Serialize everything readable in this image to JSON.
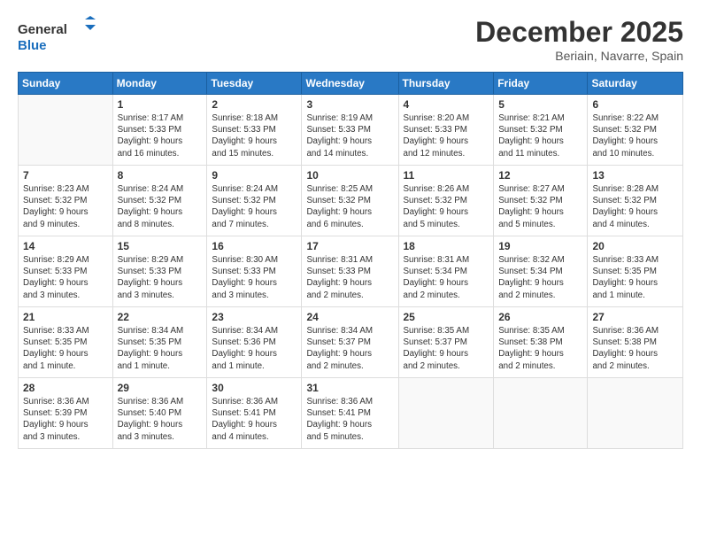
{
  "header": {
    "logo_line1": "General",
    "logo_line2": "Blue",
    "month_year": "December 2025",
    "location": "Beriain, Navarre, Spain"
  },
  "weekdays": [
    "Sunday",
    "Monday",
    "Tuesday",
    "Wednesday",
    "Thursday",
    "Friday",
    "Saturday"
  ],
  "weeks": [
    [
      {
        "day": "",
        "text": ""
      },
      {
        "day": "1",
        "text": "Sunrise: 8:17 AM\nSunset: 5:33 PM\nDaylight: 9 hours\nand 16 minutes."
      },
      {
        "day": "2",
        "text": "Sunrise: 8:18 AM\nSunset: 5:33 PM\nDaylight: 9 hours\nand 15 minutes."
      },
      {
        "day": "3",
        "text": "Sunrise: 8:19 AM\nSunset: 5:33 PM\nDaylight: 9 hours\nand 14 minutes."
      },
      {
        "day": "4",
        "text": "Sunrise: 8:20 AM\nSunset: 5:33 PM\nDaylight: 9 hours\nand 12 minutes."
      },
      {
        "day": "5",
        "text": "Sunrise: 8:21 AM\nSunset: 5:32 PM\nDaylight: 9 hours\nand 11 minutes."
      },
      {
        "day": "6",
        "text": "Sunrise: 8:22 AM\nSunset: 5:32 PM\nDaylight: 9 hours\nand 10 minutes."
      }
    ],
    [
      {
        "day": "7",
        "text": "Sunrise: 8:23 AM\nSunset: 5:32 PM\nDaylight: 9 hours\nand 9 minutes."
      },
      {
        "day": "8",
        "text": "Sunrise: 8:24 AM\nSunset: 5:32 PM\nDaylight: 9 hours\nand 8 minutes."
      },
      {
        "day": "9",
        "text": "Sunrise: 8:24 AM\nSunset: 5:32 PM\nDaylight: 9 hours\nand 7 minutes."
      },
      {
        "day": "10",
        "text": "Sunrise: 8:25 AM\nSunset: 5:32 PM\nDaylight: 9 hours\nand 6 minutes."
      },
      {
        "day": "11",
        "text": "Sunrise: 8:26 AM\nSunset: 5:32 PM\nDaylight: 9 hours\nand 5 minutes."
      },
      {
        "day": "12",
        "text": "Sunrise: 8:27 AM\nSunset: 5:32 PM\nDaylight: 9 hours\nand 5 minutes."
      },
      {
        "day": "13",
        "text": "Sunrise: 8:28 AM\nSunset: 5:32 PM\nDaylight: 9 hours\nand 4 minutes."
      }
    ],
    [
      {
        "day": "14",
        "text": "Sunrise: 8:29 AM\nSunset: 5:33 PM\nDaylight: 9 hours\nand 3 minutes."
      },
      {
        "day": "15",
        "text": "Sunrise: 8:29 AM\nSunset: 5:33 PM\nDaylight: 9 hours\nand 3 minutes."
      },
      {
        "day": "16",
        "text": "Sunrise: 8:30 AM\nSunset: 5:33 PM\nDaylight: 9 hours\nand 3 minutes."
      },
      {
        "day": "17",
        "text": "Sunrise: 8:31 AM\nSunset: 5:33 PM\nDaylight: 9 hours\nand 2 minutes."
      },
      {
        "day": "18",
        "text": "Sunrise: 8:31 AM\nSunset: 5:34 PM\nDaylight: 9 hours\nand 2 minutes."
      },
      {
        "day": "19",
        "text": "Sunrise: 8:32 AM\nSunset: 5:34 PM\nDaylight: 9 hours\nand 2 minutes."
      },
      {
        "day": "20",
        "text": "Sunrise: 8:33 AM\nSunset: 5:35 PM\nDaylight: 9 hours\nand 1 minute."
      }
    ],
    [
      {
        "day": "21",
        "text": "Sunrise: 8:33 AM\nSunset: 5:35 PM\nDaylight: 9 hours\nand 1 minute."
      },
      {
        "day": "22",
        "text": "Sunrise: 8:34 AM\nSunset: 5:35 PM\nDaylight: 9 hours\nand 1 minute."
      },
      {
        "day": "23",
        "text": "Sunrise: 8:34 AM\nSunset: 5:36 PM\nDaylight: 9 hours\nand 1 minute."
      },
      {
        "day": "24",
        "text": "Sunrise: 8:34 AM\nSunset: 5:37 PM\nDaylight: 9 hours\nand 2 minutes."
      },
      {
        "day": "25",
        "text": "Sunrise: 8:35 AM\nSunset: 5:37 PM\nDaylight: 9 hours\nand 2 minutes."
      },
      {
        "day": "26",
        "text": "Sunrise: 8:35 AM\nSunset: 5:38 PM\nDaylight: 9 hours\nand 2 minutes."
      },
      {
        "day": "27",
        "text": "Sunrise: 8:36 AM\nSunset: 5:38 PM\nDaylight: 9 hours\nand 2 minutes."
      }
    ],
    [
      {
        "day": "28",
        "text": "Sunrise: 8:36 AM\nSunset: 5:39 PM\nDaylight: 9 hours\nand 3 minutes."
      },
      {
        "day": "29",
        "text": "Sunrise: 8:36 AM\nSunset: 5:40 PM\nDaylight: 9 hours\nand 3 minutes."
      },
      {
        "day": "30",
        "text": "Sunrise: 8:36 AM\nSunset: 5:41 PM\nDaylight: 9 hours\nand 4 minutes."
      },
      {
        "day": "31",
        "text": "Sunrise: 8:36 AM\nSunset: 5:41 PM\nDaylight: 9 hours\nand 5 minutes."
      },
      {
        "day": "",
        "text": ""
      },
      {
        "day": "",
        "text": ""
      },
      {
        "day": "",
        "text": ""
      }
    ]
  ]
}
